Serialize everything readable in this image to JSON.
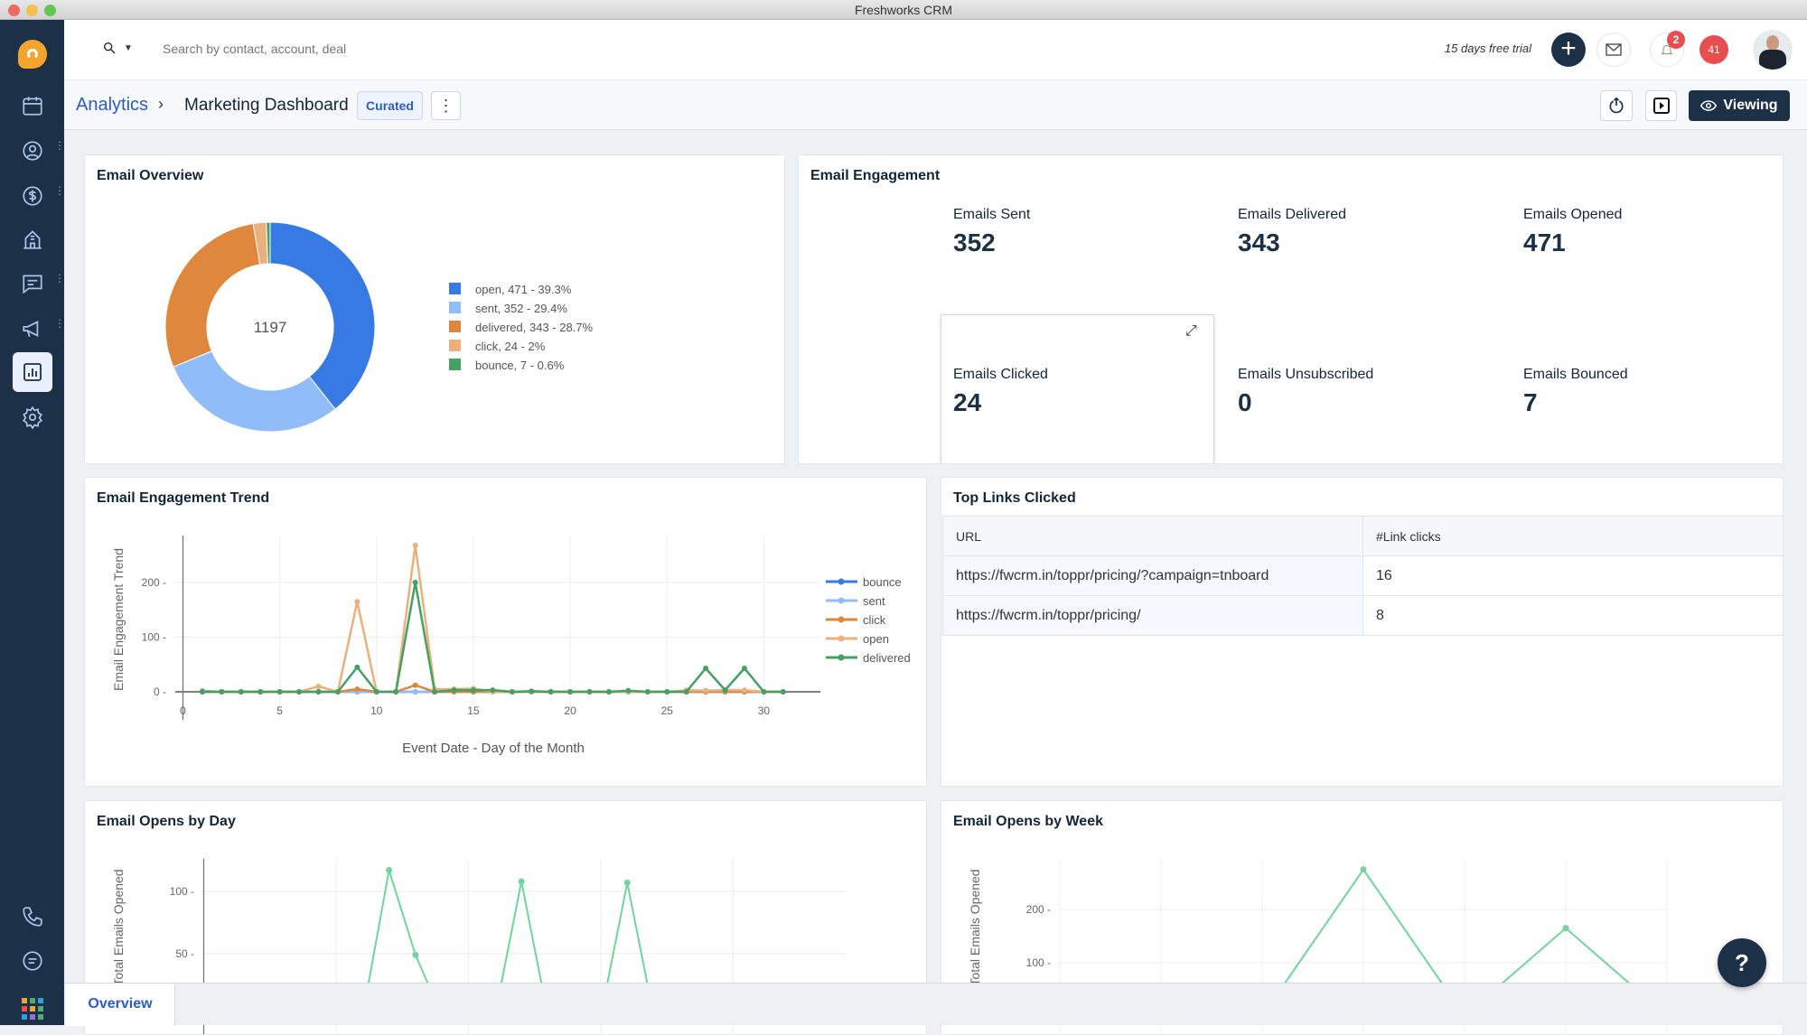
{
  "window": {
    "title": "Freshworks CRM"
  },
  "header": {
    "search_placeholder": "Search by contact, account, deal",
    "trial_text": "15 days free trial",
    "notification_count": "2",
    "alerts_count": "41"
  },
  "breadcrumb": {
    "parent": "Analytics",
    "current": "Marketing Dashboard",
    "badge": "Curated",
    "viewing_label": "Viewing"
  },
  "sidebar": {
    "items": [
      {
        "icon": "calendar-icon"
      },
      {
        "icon": "contacts-icon"
      },
      {
        "icon": "deals-icon"
      },
      {
        "icon": "accounts-icon"
      },
      {
        "icon": "conversations-icon"
      },
      {
        "icon": "campaigns-icon"
      },
      {
        "icon": "analytics-icon",
        "active": true
      },
      {
        "icon": "settings-icon"
      },
      {
        "icon": "phone-icon"
      },
      {
        "icon": "chat-icon"
      },
      {
        "icon": "apps-grid-icon"
      }
    ]
  },
  "colors": {
    "sidebar": "#1c3048",
    "accent": "#2c5cc5",
    "open": "#377ae3",
    "sent": "#91bcfa",
    "delivered": "#df873d",
    "click": "#ebb07c",
    "bounce": "#44a063",
    "opens_line": "#6fd69c"
  },
  "overview": {
    "title": "Email Overview",
    "total": "1197",
    "chart_data": {
      "type": "pie",
      "donut": true,
      "center_label": "1197",
      "legend_position": "right",
      "slices": [
        {
          "name": "open",
          "value": 471,
          "label": "open,  471 - 39.3%",
          "color": "#377ae3"
        },
        {
          "name": "sent",
          "value": 352,
          "label": "sent,  352 - 29.4%",
          "color": "#91bcfa"
        },
        {
          "name": "delivered",
          "value": 343,
          "label": "delivered,  343 - 28.7%",
          "color": "#df873d"
        },
        {
          "name": "click",
          "value": 24,
          "label": "click,  24 - 2%",
          "color": "#ebb07c"
        },
        {
          "name": "bounce",
          "value": 7,
          "label": "bounce,  7 - 0.6%",
          "color": "#44a063"
        }
      ]
    }
  },
  "engagement": {
    "title": "Email Engagement",
    "metrics": [
      {
        "label": "Emails Sent",
        "value": "352"
      },
      {
        "label": "Emails Delivered",
        "value": "343"
      },
      {
        "label": "Emails Opened",
        "value": "471"
      },
      {
        "label": "Emails Clicked",
        "value": "24"
      },
      {
        "label": "Emails Unsubscribed",
        "value": "0"
      },
      {
        "label": "Emails Bounced",
        "value": "7"
      }
    ]
  },
  "trend": {
    "title": "Email Engagement Trend",
    "chart_data": {
      "type": "line",
      "xlabel": "Event Date - Day of the Month",
      "ylabel": "Email Engagement Trend",
      "xlim": [
        0,
        33
      ],
      "ylim": [
        -15,
        286
      ],
      "xticks": [
        0,
        5,
        10,
        15,
        20,
        25,
        30
      ],
      "yticks": [
        0,
        100,
        200
      ],
      "grid": true,
      "legend_position": "right",
      "x": [
        1,
        2,
        3,
        4,
        5,
        6,
        7,
        8,
        9,
        10,
        11,
        12,
        13,
        14,
        15,
        16,
        17,
        18,
        19,
        20,
        21,
        22,
        23,
        24,
        25,
        26,
        27,
        28,
        29,
        30,
        31
      ],
      "series": [
        {
          "name": "bounce",
          "color": "#377ae3",
          "values": [
            0,
            0,
            0,
            0,
            0,
            0,
            0,
            0,
            0,
            0,
            0,
            0,
            0,
            0,
            0,
            0,
            0,
            0,
            0,
            0,
            0,
            0,
            0,
            0,
            0,
            0,
            0,
            0,
            0,
            0,
            0
          ]
        },
        {
          "name": "sent",
          "color": "#91bcfa",
          "values": [
            2,
            0,
            0,
            0,
            0,
            0,
            0,
            0,
            0,
            0,
            0,
            0,
            0,
            3,
            1,
            3,
            0,
            1,
            0,
            0,
            0,
            0,
            1,
            0,
            0,
            0,
            0,
            0,
            0,
            0,
            0
          ]
        },
        {
          "name": "click",
          "color": "#df873d",
          "values": [
            0,
            0,
            0,
            0,
            0,
            0,
            0,
            0,
            5,
            0,
            0,
            12,
            0,
            0,
            0,
            0,
            0,
            0,
            0,
            0,
            0,
            0,
            0,
            0,
            0,
            0,
            0,
            0,
            0,
            0,
            0
          ]
        },
        {
          "name": "open",
          "color": "#ebb07c",
          "values": [
            0,
            0,
            0,
            0,
            0,
            0,
            10,
            0,
            165,
            0,
            0,
            268,
            5,
            5,
            6,
            0,
            0,
            0,
            0,
            0,
            0,
            0,
            0,
            0,
            0,
            3,
            2,
            3,
            3,
            0,
            0
          ]
        },
        {
          "name": "delivered",
          "color": "#44a063",
          "values": [
            0,
            0,
            0,
            0,
            0,
            0,
            0,
            0,
            45,
            0,
            0,
            200,
            0,
            3,
            3,
            3,
            0,
            1,
            0,
            0,
            0,
            0,
            2,
            0,
            0,
            0,
            43,
            3,
            43,
            0,
            0
          ]
        }
      ]
    }
  },
  "top_links": {
    "title": "Top Links Clicked",
    "columns": [
      "URL",
      "#Link clicks"
    ],
    "rows": [
      {
        "url": "https://fwcrm.in/toppr/pricing/?campaign=tnboard",
        "clicks": "16"
      },
      {
        "url": "https://fwcrm.in/toppr/pricing/",
        "clicks": "8"
      }
    ]
  },
  "opens_day": {
    "title": "Email Opens by Day",
    "chart_data": {
      "type": "line",
      "ylabel": "Total Emails Opened",
      "xlim": [
        0,
        24.3
      ],
      "ylim": [
        0,
        126
      ],
      "yticks": [
        50,
        100
      ],
      "grid": true,
      "color": "#6fd69c",
      "x": [
        5,
        6,
        7,
        8,
        9,
        10,
        11,
        12,
        13,
        14,
        15,
        16,
        17,
        18
      ],
      "values": [
        0,
        0,
        117,
        49,
        0,
        0,
        0,
        108,
        0,
        0,
        0,
        107,
        0,
        0
      ]
    }
  },
  "opens_week": {
    "title": "Email Opens by Week",
    "chart_data": {
      "type": "line",
      "ylabel": "Total Emails Opened",
      "xlim": [
        0,
        6
      ],
      "ylim": [
        0,
        295
      ],
      "yticks": [
        100,
        200
      ],
      "grid": true,
      "color": "#6fd69c",
      "x": [
        2,
        3,
        4,
        5,
        6
      ],
      "values": [
        0,
        275,
        0,
        165,
        0
      ]
    }
  },
  "bottom_tabs": [
    {
      "label": "Overview",
      "active": true
    }
  ]
}
